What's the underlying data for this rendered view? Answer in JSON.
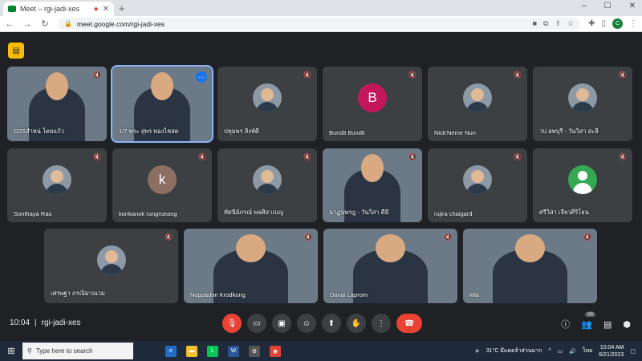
{
  "browser": {
    "tab_title": "Meet – rgi-jadi-xes",
    "url": "meet.google.com/rgi-jadi-xes",
    "profile_initial": "C"
  },
  "meeting": {
    "time": "10:04",
    "code": "rgi-jadi-xes",
    "participant_count": "16",
    "tiles": [
      {
        "name": "O2Sสำหน่ โคยแก้ว",
        "kind": "video"
      },
      {
        "name": "1/7 พระ สุพร ทองไชสด",
        "kind": "video"
      },
      {
        "name": "ปทุมพร สิงห์ดี",
        "kind": "photo"
      },
      {
        "name": "Bundit Bundit",
        "kind": "letter",
        "initial": "B",
        "color": "#c2185b"
      },
      {
        "name": "Nick'Neme Nun",
        "kind": "photo"
      },
      {
        "name": "วป ลพบุรี - วันวิสา สะลี",
        "kind": "photo"
      },
      {
        "name": "Sonthaya Rao",
        "kind": "photo"
      },
      {
        "name": "konkanok rungrueang",
        "kind": "letter",
        "initial": "k",
        "color": "#8d6e63"
      },
      {
        "name": "ทัศนีย์ภรณ์ พลศิลาเบญ",
        "kind": "photo"
      },
      {
        "name": "นาฏนพรฎ - วันวิสา ดีมี",
        "kind": "video"
      },
      {
        "name": "rujira chaigard",
        "kind": "photo"
      },
      {
        "name": "ศรีวิสา เจียวศิริโยน",
        "kind": "generic"
      },
      {
        "name": "เศรษฐา ภรณิมาณวม",
        "kind": "photo"
      },
      {
        "name": "Noppadon Krodkong",
        "kind": "video"
      },
      {
        "name": "Danai Laprom",
        "kind": "video"
      },
      {
        "name": "Mia",
        "kind": "video"
      }
    ]
  },
  "taskbar": {
    "search_placeholder": "Type here to search",
    "weather": "31°C มีแดดจ้าส่วนมาก",
    "lang": "ไทย",
    "clock_time": "10:04 AM",
    "clock_date": "6/21/2023"
  }
}
